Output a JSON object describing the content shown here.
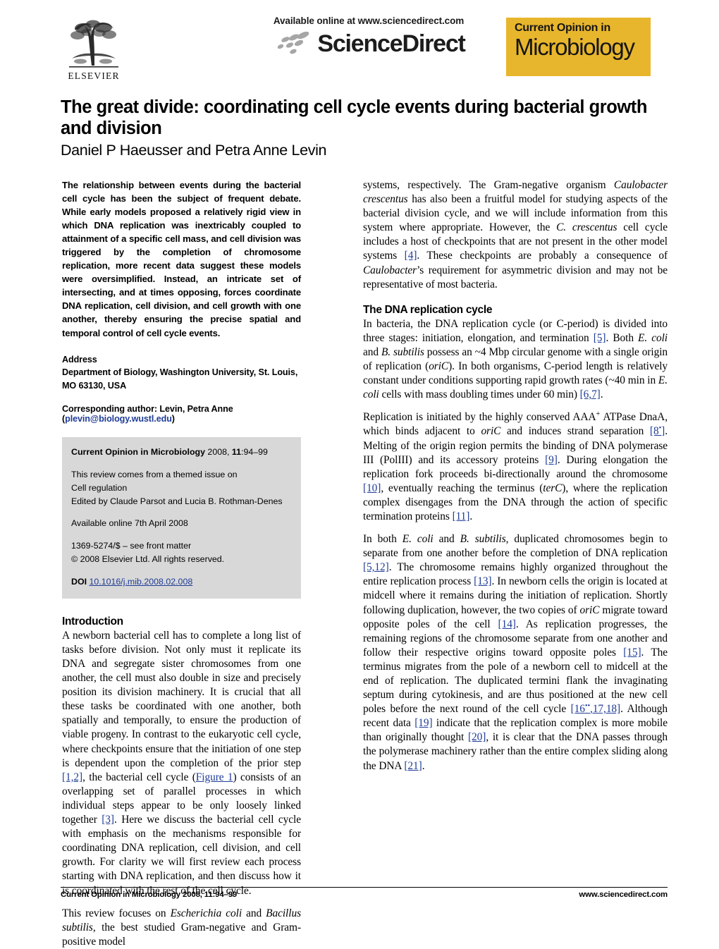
{
  "masthead": {
    "publisher_name": "ELSEVIER",
    "elsevier_logo_alt": "elsevier-tree-logo",
    "sciencedirect_available": "Available online at www.sciencedirect.com",
    "sciencedirect_word": "ScienceDirect",
    "journal_banner_line1": "Current Opinion in",
    "journal_banner_line2": "Microbiology",
    "journal_banner_color": "#e8b62c"
  },
  "article": {
    "title": "The great divide: coordinating cell cycle events during bacterial growth and division",
    "authors": "Daniel P Haeusser and Petra Anne Levin"
  },
  "abstract": {
    "text": "The relationship between events during the bacterial cell cycle has been the subject of frequent debate. While early models proposed a relatively rigid view in which DNA replication was inextricably coupled to attainment of a specific cell mass, and cell division was triggered by the completion of chromosome replication, more recent data suggest these models were oversimplified. Instead, an intricate set of intersecting, and at times opposing, forces coordinate DNA replication, cell division, and cell growth with one another, thereby ensuring the precise spatial and temporal control of cell cycle events."
  },
  "address": {
    "heading": "Address",
    "line1": "Department of Biology, Washington University, St. Louis,",
    "line2": "MO 63130, USA",
    "corresponding_prefix": "Corresponding author: Levin, Petra Anne (",
    "corresponding_email": "plevin@biology.wustl.edu",
    "corresponding_suffix": ")"
  },
  "infobox": {
    "journal_name": "Current Opinion in Microbiology",
    "citation": " 2008, ",
    "volume": "11",
    "pages": ":94–99",
    "themed_line1": "This review comes from a themed issue on",
    "themed_line2": "Cell regulation",
    "themed_line3": "Edited by Claude Parsot and Lucia B. Rothman-Denes",
    "available_online": "Available online 7th April 2008",
    "issn_line": "1369-5274/$ – see front matter",
    "copyright_line": "© 2008 Elsevier Ltd. All rights reserved.",
    "doi_label": "DOI",
    "doi_value": "10.1016/j.mib.2008.02.008",
    "background_color": "#d8d8d8",
    "link_color": "#1f3c96"
  },
  "introduction": {
    "heading": "Introduction",
    "p1_a": "A newborn bacterial cell has to complete a long list of tasks before division. Not only must it replicate its DNA and segregate sister chromosomes from one another, the cell must also double in size and precisely position its division machinery. It is crucial that all these tasks be coordinated with one another, both spatially and temporally, to ensure the production of viable progeny. In contrast to the eukaryotic cell cycle, where checkpoints ensure that the initiation of one step is dependent upon the completion of the prior step ",
    "p1_ref1": "[1,2]",
    "p1_b": ", the bacterial cell cycle (",
    "p1_figref": "Figure 1",
    "p1_c": ") consists of an overlapping set of parallel processes in which individual steps appear to be only loosely linked together ",
    "p1_ref2": "[3]",
    "p1_d": ". Here we discuss the bacterial cell cycle with emphasis on the mechanisms responsible for coordinating DNA replication, cell division, and cell growth. For clarity we will first review each process starting with DNA replication, and then discuss how it is coordinated with the rest of the cell cycle.",
    "p2_a": "This review focuses on ",
    "p2_sp1": "Escherichia coli",
    "p2_b": " and ",
    "p2_sp2": "Bacillus subtilis",
    "p2_c": ", the best studied Gram-negative and Gram-positive model"
  },
  "right_column": {
    "cont_a": "systems, respectively. The Gram-negative organism ",
    "cont_sp1": "Caulobacter crescentus",
    "cont_b": " has also been a fruitful model for studying aspects of the bacterial division cycle, and we will include information from this system where appropriate. However, the ",
    "cont_sp2": "C. crescentus",
    "cont_c": " cell cycle includes a host of checkpoints that are not present in the other model systems ",
    "cont_ref1": "[4]",
    "cont_d": ". These checkpoints are probably a consequence of ",
    "cont_sp3": "Caulobacter",
    "cont_e": "’s requirement for asymmetric division and may not be representative of most bacteria.",
    "dna_heading": "The DNA replication cycle",
    "dna_p1_a": "In bacteria, the DNA replication cycle (or C-period) is divided into three stages: initiation, elongation, and termination ",
    "dna_p1_ref1": "[5]",
    "dna_p1_b": ". Both ",
    "dna_p1_sp1": "E. coli",
    "dna_p1_c": " and ",
    "dna_p1_sp2": "B. subtilis",
    "dna_p1_d": " possess an ~4 Mbp circular genome with a single origin of replication (",
    "dna_p1_sp3": "oriC",
    "dna_p1_e": "). In both organisms, C-period length is relatively constant under conditions supporting rapid growth rates (~40 min in ",
    "dna_p1_sp4": "E. coli",
    "dna_p1_f": " cells with mass doubling times under 60 min) ",
    "dna_p1_ref2": "[6,7]",
    "dna_p1_g": ".",
    "dna_p2_a": "Replication is initiated by the highly conserved AAA",
    "dna_p2_sup": "+",
    "dna_p2_b": " ATPase DnaA, which binds adjacent to ",
    "dna_p2_sp1": "oriC",
    "dna_p2_c": " and induces strand separation ",
    "dna_p2_ref1": "[8",
    "dna_p2_ref1sup": "•",
    "dna_p2_ref1b": "]",
    "dna_p2_d": ". Melting of the origin region permits the binding of DNA polymerase III (PolIII) and its accessory proteins ",
    "dna_p2_ref2": "[9]",
    "dna_p2_e": ". During elongation the replication fork proceeds bi-directionally around the chromosome ",
    "dna_p2_ref3": "[10]",
    "dna_p2_f": ", eventually reaching the terminus (",
    "dna_p2_sp2": "terC",
    "dna_p2_g": "), where the replication complex disengages from the DNA through the action of specific termination proteins ",
    "dna_p2_ref4": "[11]",
    "dna_p2_h": ".",
    "dna_p3_a": "In both ",
    "dna_p3_sp1": "E. coli",
    "dna_p3_b": " and ",
    "dna_p3_sp2": "B. subtilis",
    "dna_p3_c": ", duplicated chromosomes begin to separate from one another before the completion of DNA replication ",
    "dna_p3_ref1": "[5,12]",
    "dna_p3_d": ". The chromosome remains highly organized throughout the entire replication process ",
    "dna_p3_ref2": "[13]",
    "dna_p3_e": ". In newborn cells the origin is located at midcell where it remains during the initiation of replication. Shortly following duplication, however, the two copies of ",
    "dna_p3_sp3": "oriC",
    "dna_p3_f": " migrate toward opposite poles of the cell ",
    "dna_p3_ref3": "[14]",
    "dna_p3_g": ". As replication progresses, the remaining regions of the chromosome separate from one another and follow their respective origins toward opposite poles ",
    "dna_p3_ref4": "[15]",
    "dna_p3_h": ". The terminus migrates from the pole of a newborn cell to midcell at the end of replication. The duplicated termini flank the invaginating septum during cytokinesis, and are thus positioned at the new cell poles before the next round of the cell cycle ",
    "dna_p3_ref5": "[16",
    "dna_p3_ref5sup": "••",
    "dna_p3_ref5b": ",17,18]",
    "dna_p3_i": ". Although recent data ",
    "dna_p3_ref6": "[19]",
    "dna_p3_j": " indicate that the replication complex is more mobile than originally thought ",
    "dna_p3_ref7": "[20]",
    "dna_p3_k": ", it is clear that the DNA passes through the polymerase machinery rather than the entire complex sliding along the DNA ",
    "dna_p3_ref8": "[21]",
    "dna_p3_l": "."
  },
  "footer": {
    "left_journal": "Current Opinion in Microbiology",
    "left_citation": " 2008, 11:94–99",
    "right": "www.sciencedirect.com"
  }
}
